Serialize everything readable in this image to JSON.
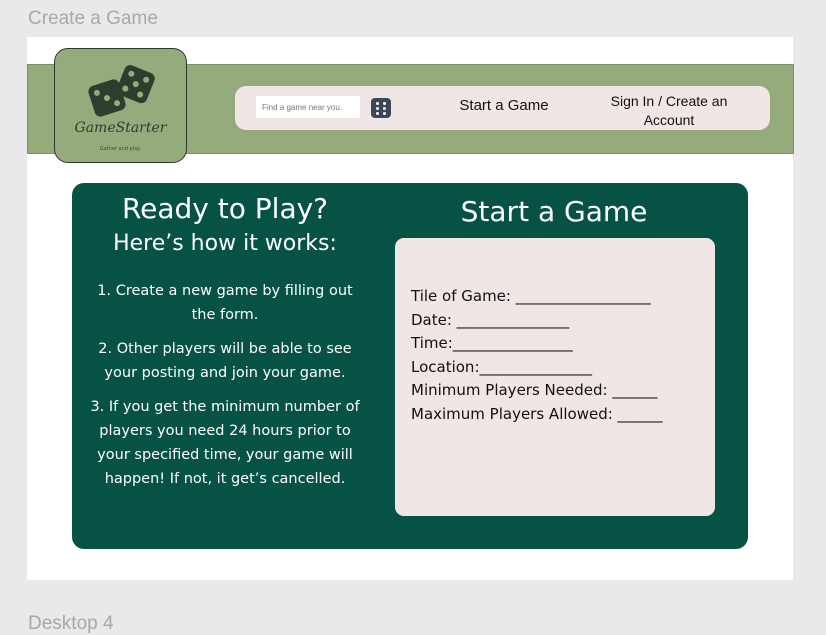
{
  "canvas": {
    "frame_title": "Create a Game",
    "next_frame_title": "Desktop 4"
  },
  "colors": {
    "header_green": "#96ab7b",
    "card_green": "#065244",
    "panel_pink": "#f0e6e6",
    "dice_dark": "#3d4658"
  },
  "logo": {
    "name": "GameStarter",
    "tagline": "Gather and play.",
    "icon": "dice-icon"
  },
  "nav": {
    "search_placeholder": "Find a game near you.",
    "dice_icon": "dice-icon",
    "start_game": "Start a Game",
    "signin_line1": "Sign In / Create an",
    "signin_line2": "Account"
  },
  "howto": {
    "title": "Ready to Play?",
    "subtitle": "Here’s how it works:",
    "steps": [
      "1. Create a new game by filling out the form.",
      "2. Other players will be able to see your posting and join your game.",
      "3. If you get the minimum number of players you need 24 hours prior to  your specified time, your game will happen!  If not, it get’s cancelled."
    ]
  },
  "form": {
    "title": "Start a Game",
    "fields": [
      "Tile of Game: __________________",
      "Date: _______________",
      "Time:________________",
      "Location:_______________",
      "Minimum Players Needed: ______",
      "Maximum Players Allowed: ______"
    ]
  }
}
